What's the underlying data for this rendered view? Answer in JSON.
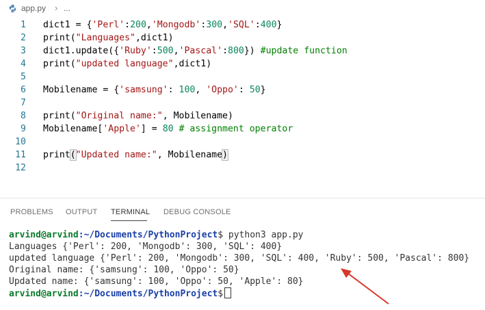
{
  "breadcrumb": {
    "file": "app.py",
    "separator": "›",
    "more": "..."
  },
  "editor": {
    "lines": [
      {
        "num": "1",
        "tokens": [
          [
            "t",
            "dict1 = {"
          ],
          [
            "s",
            "'Perl'"
          ],
          [
            "t",
            ":"
          ],
          [
            "n",
            "200"
          ],
          [
            "t",
            ","
          ],
          [
            "s",
            "'Mongodb'"
          ],
          [
            "t",
            ":"
          ],
          [
            "n",
            "300"
          ],
          [
            "t",
            ","
          ],
          [
            "s",
            "'SQL'"
          ],
          [
            "t",
            ":"
          ],
          [
            "n",
            "400"
          ],
          [
            "t",
            "}"
          ]
        ]
      },
      {
        "num": "2",
        "tokens": [
          [
            "t",
            "print("
          ],
          [
            "s",
            "\"Languages\""
          ],
          [
            "t",
            ",dict1)"
          ]
        ]
      },
      {
        "num": "3",
        "tokens": [
          [
            "t",
            "dict1.update({"
          ],
          [
            "s",
            "'Ruby'"
          ],
          [
            "t",
            ":"
          ],
          [
            "n",
            "500"
          ],
          [
            "t",
            ","
          ],
          [
            "s",
            "'Pascal'"
          ],
          [
            "t",
            ":"
          ],
          [
            "n",
            "800"
          ],
          [
            "t",
            "}) "
          ],
          [
            "c",
            "#update function"
          ]
        ]
      },
      {
        "num": "4",
        "tokens": [
          [
            "t",
            "print("
          ],
          [
            "s",
            "\"updated language\""
          ],
          [
            "t",
            ",dict1)"
          ]
        ]
      },
      {
        "num": "5",
        "tokens": []
      },
      {
        "num": "6",
        "tokens": [
          [
            "t",
            "Mobilename = {"
          ],
          [
            "s",
            "'samsung'"
          ],
          [
            "t",
            ": "
          ],
          [
            "n",
            "100"
          ],
          [
            "t",
            ", "
          ],
          [
            "s",
            "'Oppo'"
          ],
          [
            "t",
            ": "
          ],
          [
            "n",
            "50"
          ],
          [
            "t",
            "}"
          ]
        ]
      },
      {
        "num": "7",
        "tokens": []
      },
      {
        "num": "8",
        "tokens": [
          [
            "t",
            "print("
          ],
          [
            "s",
            "\"Original name:\""
          ],
          [
            "t",
            ", Mobilename)"
          ]
        ]
      },
      {
        "num": "9",
        "tokens": [
          [
            "t",
            "Mobilename["
          ],
          [
            "s",
            "'Apple'"
          ],
          [
            "t",
            "] = "
          ],
          [
            "n",
            "80"
          ],
          [
            "t",
            " "
          ],
          [
            "c",
            "# assignment operator"
          ]
        ]
      },
      {
        "num": "10",
        "tokens": []
      },
      {
        "num": "11",
        "tokens": [
          [
            "t",
            "print"
          ],
          [
            "b",
            "("
          ],
          [
            "s",
            "\"Updated name:\""
          ],
          [
            "t",
            ", Mobilename"
          ],
          [
            "b",
            ")"
          ]
        ]
      },
      {
        "num": "12",
        "tokens": []
      }
    ]
  },
  "panel": {
    "tabs": [
      "PROBLEMS",
      "OUTPUT",
      "TERMINAL",
      "DEBUG CONSOLE"
    ],
    "active_tab": "TERMINAL"
  },
  "terminal": {
    "prompt_user": "arvind@arvind",
    "prompt_path": ":~/Documents/PythonProject",
    "prompt_symbol": "$",
    "command": " python3 app.py",
    "output": [
      "Languages {'Perl': 200, 'Mongodb': 300, 'SQL': 400}",
      "updated language {'Perl': 200, 'Mongodb': 300, 'SQL': 400, 'Ruby': 500, 'Pascal': 800}",
      "Original name: {'samsung': 100, 'Oppo': 50}",
      "Updated name: {'samsung': 100, 'Oppo': 50, 'Apple': 80}"
    ]
  },
  "colors": {
    "string": "#a31515",
    "number": "#098658",
    "comment": "#008000",
    "line_number": "#237893",
    "prompt_user": "#0a7a2a",
    "prompt_path": "#1a3fa6",
    "arrow": "#d9362b"
  },
  "icons": {
    "file_icon": "python-file-icon",
    "annotation": "red-arrow-icon"
  }
}
